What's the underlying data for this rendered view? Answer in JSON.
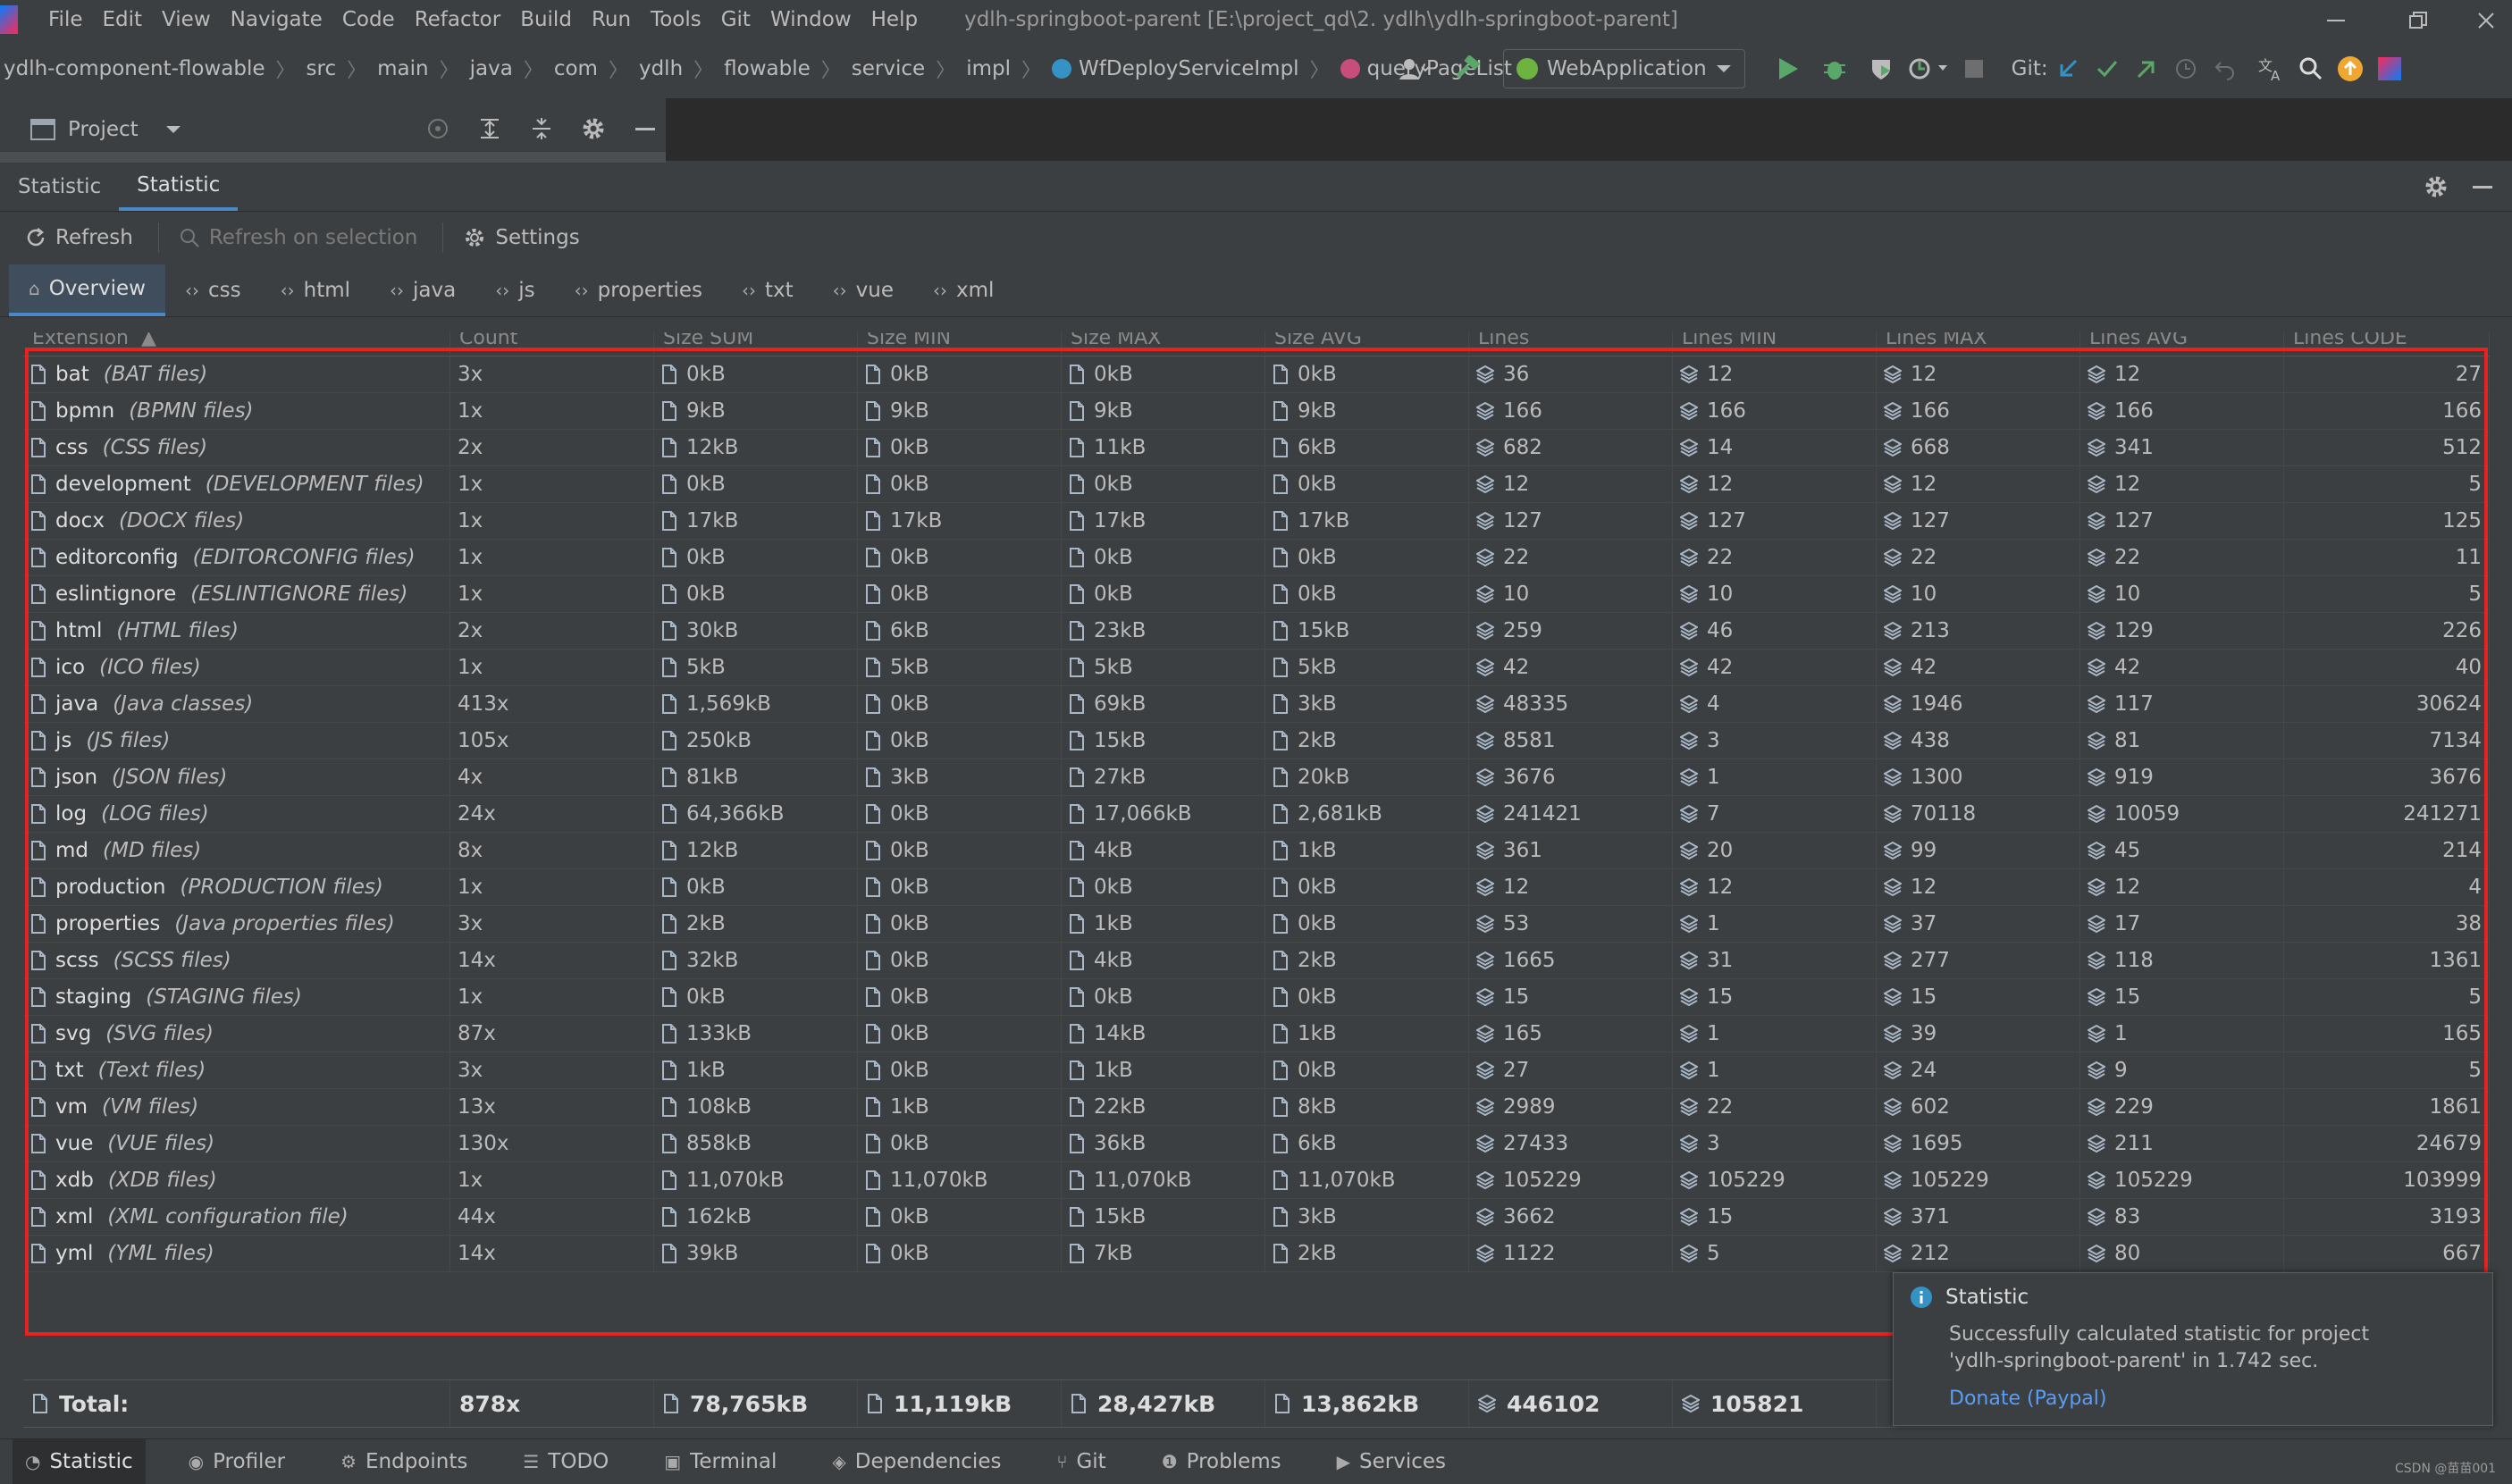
{
  "menu": {
    "items": [
      "File",
      "Edit",
      "View",
      "Navigate",
      "Code",
      "Refactor",
      "Build",
      "Run",
      "Tools",
      "Git",
      "Window",
      "Help"
    ],
    "window_title": "ydlh-springboot-parent [E:\\project_qd\\2. ydlh\\ydlh-springboot-parent]"
  },
  "nav": {
    "crumbs": [
      "ydlh-component-flowable",
      "src",
      "main",
      "java",
      "com",
      "ydlh",
      "flowable",
      "service",
      "impl",
      "WfDeployServiceImpl",
      "queryPageList"
    ],
    "run_config": "WebApplication",
    "git_label": "Git:"
  },
  "project": {
    "label": "Project"
  },
  "stat_tabs": [
    "Statistic",
    "Statistic"
  ],
  "toolbar": {
    "refresh": "Refresh",
    "refresh_selection": "Refresh on selection",
    "settings": "Settings"
  },
  "ext_tabs": [
    "Overview",
    "css",
    "html",
    "java",
    "js",
    "properties",
    "txt",
    "vue",
    "xml"
  ],
  "table": {
    "headers": [
      "Extension",
      "Count",
      "Size SUM",
      "Size MIN",
      "Size MAX",
      "Size AVG",
      "Lines",
      "Lines MIN",
      "Lines MAX",
      "Lines AVG",
      "Lines CODE"
    ],
    "sort_indicator": "▲",
    "rows": [
      {
        "ext": "bat",
        "desc": "(BAT files)",
        "count": "3x",
        "size_sum": "0kB",
        "size_min": "0kB",
        "size_max": "0kB",
        "size_avg": "0kB",
        "lines": "36",
        "lines_min": "12",
        "lines_max": "12",
        "lines_avg": "12",
        "lines_code": "27"
      },
      {
        "ext": "bpmn",
        "desc": "(BPMN files)",
        "count": "1x",
        "size_sum": "9kB",
        "size_min": "9kB",
        "size_max": "9kB",
        "size_avg": "9kB",
        "lines": "166",
        "lines_min": "166",
        "lines_max": "166",
        "lines_avg": "166",
        "lines_code": "166"
      },
      {
        "ext": "css",
        "desc": "(CSS files)",
        "count": "2x",
        "size_sum": "12kB",
        "size_min": "0kB",
        "size_max": "11kB",
        "size_avg": "6kB",
        "lines": "682",
        "lines_min": "14",
        "lines_max": "668",
        "lines_avg": "341",
        "lines_code": "512"
      },
      {
        "ext": "development",
        "desc": "(DEVELOPMENT files)",
        "count": "1x",
        "size_sum": "0kB",
        "size_min": "0kB",
        "size_max": "0kB",
        "size_avg": "0kB",
        "lines": "12",
        "lines_min": "12",
        "lines_max": "12",
        "lines_avg": "12",
        "lines_code": "5"
      },
      {
        "ext": "docx",
        "desc": "(DOCX files)",
        "count": "1x",
        "size_sum": "17kB",
        "size_min": "17kB",
        "size_max": "17kB",
        "size_avg": "17kB",
        "lines": "127",
        "lines_min": "127",
        "lines_max": "127",
        "lines_avg": "127",
        "lines_code": "125"
      },
      {
        "ext": "editorconfig",
        "desc": "(EDITORCONFIG files)",
        "count": "1x",
        "size_sum": "0kB",
        "size_min": "0kB",
        "size_max": "0kB",
        "size_avg": "0kB",
        "lines": "22",
        "lines_min": "22",
        "lines_max": "22",
        "lines_avg": "22",
        "lines_code": "11"
      },
      {
        "ext": "eslintignore",
        "desc": "(ESLINTIGNORE files)",
        "count": "1x",
        "size_sum": "0kB",
        "size_min": "0kB",
        "size_max": "0kB",
        "size_avg": "0kB",
        "lines": "10",
        "lines_min": "10",
        "lines_max": "10",
        "lines_avg": "10",
        "lines_code": "5"
      },
      {
        "ext": "html",
        "desc": "(HTML files)",
        "count": "2x",
        "size_sum": "30kB",
        "size_min": "6kB",
        "size_max": "23kB",
        "size_avg": "15kB",
        "lines": "259",
        "lines_min": "46",
        "lines_max": "213",
        "lines_avg": "129",
        "lines_code": "226"
      },
      {
        "ext": "ico",
        "desc": "(ICO files)",
        "count": "1x",
        "size_sum": "5kB",
        "size_min": "5kB",
        "size_max": "5kB",
        "size_avg": "5kB",
        "lines": "42",
        "lines_min": "42",
        "lines_max": "42",
        "lines_avg": "42",
        "lines_code": "40"
      },
      {
        "ext": "java",
        "desc": "(Java classes)",
        "count": "413x",
        "size_sum": "1,569kB",
        "size_min": "0kB",
        "size_max": "69kB",
        "size_avg": "3kB",
        "lines": "48335",
        "lines_min": "4",
        "lines_max": "1946",
        "lines_avg": "117",
        "lines_code": "30624"
      },
      {
        "ext": "js",
        "desc": "(JS files)",
        "count": "105x",
        "size_sum": "250kB",
        "size_min": "0kB",
        "size_max": "15kB",
        "size_avg": "2kB",
        "lines": "8581",
        "lines_min": "3",
        "lines_max": "438",
        "lines_avg": "81",
        "lines_code": "7134"
      },
      {
        "ext": "json",
        "desc": "(JSON files)",
        "count": "4x",
        "size_sum": "81kB",
        "size_min": "3kB",
        "size_max": "27kB",
        "size_avg": "20kB",
        "lines": "3676",
        "lines_min": "1",
        "lines_max": "1300",
        "lines_avg": "919",
        "lines_code": "3676"
      },
      {
        "ext": "log",
        "desc": "(LOG files)",
        "count": "24x",
        "size_sum": "64,366kB",
        "size_min": "0kB",
        "size_max": "17,066kB",
        "size_avg": "2,681kB",
        "lines": "241421",
        "lines_min": "7",
        "lines_max": "70118",
        "lines_avg": "10059",
        "lines_code": "241271"
      },
      {
        "ext": "md",
        "desc": "(MD files)",
        "count": "8x",
        "size_sum": "12kB",
        "size_min": "0kB",
        "size_max": "4kB",
        "size_avg": "1kB",
        "lines": "361",
        "lines_min": "20",
        "lines_max": "99",
        "lines_avg": "45",
        "lines_code": "214"
      },
      {
        "ext": "production",
        "desc": "(PRODUCTION files)",
        "count": "1x",
        "size_sum": "0kB",
        "size_min": "0kB",
        "size_max": "0kB",
        "size_avg": "0kB",
        "lines": "12",
        "lines_min": "12",
        "lines_max": "12",
        "lines_avg": "12",
        "lines_code": "4"
      },
      {
        "ext": "properties",
        "desc": "(Java properties files)",
        "count": "3x",
        "size_sum": "2kB",
        "size_min": "0kB",
        "size_max": "1kB",
        "size_avg": "0kB",
        "lines": "53",
        "lines_min": "1",
        "lines_max": "37",
        "lines_avg": "17",
        "lines_code": "38"
      },
      {
        "ext": "scss",
        "desc": "(SCSS files)",
        "count": "14x",
        "size_sum": "32kB",
        "size_min": "0kB",
        "size_max": "4kB",
        "size_avg": "2kB",
        "lines": "1665",
        "lines_min": "31",
        "lines_max": "277",
        "lines_avg": "118",
        "lines_code": "1361"
      },
      {
        "ext": "staging",
        "desc": "(STAGING files)",
        "count": "1x",
        "size_sum": "0kB",
        "size_min": "0kB",
        "size_max": "0kB",
        "size_avg": "0kB",
        "lines": "15",
        "lines_min": "15",
        "lines_max": "15",
        "lines_avg": "15",
        "lines_code": "5"
      },
      {
        "ext": "svg",
        "desc": "(SVG files)",
        "count": "87x",
        "size_sum": "133kB",
        "size_min": "0kB",
        "size_max": "14kB",
        "size_avg": "1kB",
        "lines": "165",
        "lines_min": "1",
        "lines_max": "39",
        "lines_avg": "1",
        "lines_code": "165"
      },
      {
        "ext": "txt",
        "desc": "(Text files)",
        "count": "3x",
        "size_sum": "1kB",
        "size_min": "0kB",
        "size_max": "1kB",
        "size_avg": "0kB",
        "lines": "27",
        "lines_min": "1",
        "lines_max": "24",
        "lines_avg": "9",
        "lines_code": "5"
      },
      {
        "ext": "vm",
        "desc": "(VM files)",
        "count": "13x",
        "size_sum": "108kB",
        "size_min": "1kB",
        "size_max": "22kB",
        "size_avg": "8kB",
        "lines": "2989",
        "lines_min": "22",
        "lines_max": "602",
        "lines_avg": "229",
        "lines_code": "1861"
      },
      {
        "ext": "vue",
        "desc": "(VUE files)",
        "count": "130x",
        "size_sum": "858kB",
        "size_min": "0kB",
        "size_max": "36kB",
        "size_avg": "6kB",
        "lines": "27433",
        "lines_min": "3",
        "lines_max": "1695",
        "lines_avg": "211",
        "lines_code": "24679"
      },
      {
        "ext": "xdb",
        "desc": "(XDB files)",
        "count": "1x",
        "size_sum": "11,070kB",
        "size_min": "11,070kB",
        "size_max": "11,070kB",
        "size_avg": "11,070kB",
        "lines": "105229",
        "lines_min": "105229",
        "lines_max": "105229",
        "lines_avg": "105229",
        "lines_code": "103999"
      },
      {
        "ext": "xml",
        "desc": "(XML configuration file)",
        "count": "44x",
        "size_sum": "162kB",
        "size_min": "0kB",
        "size_max": "15kB",
        "size_avg": "3kB",
        "lines": "3662",
        "lines_min": "15",
        "lines_max": "371",
        "lines_avg": "83",
        "lines_code": "3193"
      },
      {
        "ext": "yml",
        "desc": "(YML files)",
        "count": "14x",
        "size_sum": "39kB",
        "size_min": "0kB",
        "size_max": "7kB",
        "size_avg": "2kB",
        "lines": "1122",
        "lines_min": "5",
        "lines_max": "212",
        "lines_avg": "80",
        "lines_code": "667"
      }
    ]
  },
  "total": {
    "label": "Total:",
    "count": "878x",
    "size_sum": "78,765kB",
    "size_min": "11,119kB",
    "size_max": "28,427kB",
    "size_avg": "13,862kB",
    "lines": "446102",
    "lines_min": "105821"
  },
  "notification": {
    "title": "Statistic",
    "message_line1": "Successfully calculated statistic for project",
    "message_line2": "'ydlh-springboot-parent' in 1.742 sec.",
    "link": "Donate (Paypal)"
  },
  "bottom": {
    "items": [
      "Statistic",
      "Profiler",
      "Endpoints",
      "TODO",
      "Terminal",
      "Dependencies",
      "Git",
      "Problems",
      "Services"
    ],
    "watermark": "CSDN @苗苗001"
  },
  "colors": {
    "accent": "#4a88c7",
    "highlight": "#e8221f",
    "run_green": "#59a869",
    "info_blue": "#3592c4",
    "link": "#589df6"
  }
}
